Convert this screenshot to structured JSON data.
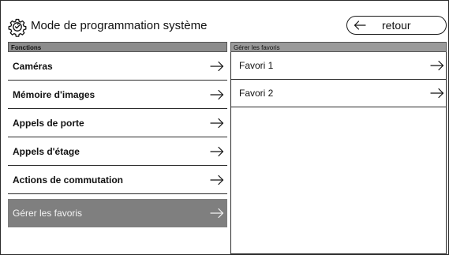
{
  "header": {
    "title": "Mode de programmation système",
    "back_label": "retour",
    "icon": "gear-icon"
  },
  "left_panel": {
    "header": "Fonctions",
    "items": [
      {
        "label": "Caméras",
        "active": false
      },
      {
        "label": "Mémoire d'images",
        "active": false
      },
      {
        "label": "Appels de porte",
        "active": false
      },
      {
        "label": "Appels d'étage",
        "active": false
      },
      {
        "label": "Actions de commutation",
        "active": false
      },
      {
        "label": "Gérer les favoris",
        "active": true
      }
    ]
  },
  "right_panel": {
    "header": "Gérer les favoris",
    "items": [
      {
        "label": "Favori 1"
      },
      {
        "label": "Favori 2"
      }
    ]
  },
  "colors": {
    "panel_header": "#8c8c8c",
    "active_item": "#7f7f7f",
    "active_text": "#f4f4f4",
    "border": "#2a2a2a"
  }
}
